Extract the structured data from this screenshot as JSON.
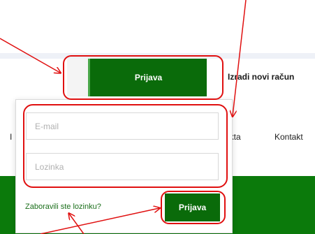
{
  "header": {
    "login_tab_label": "Prijava",
    "register_label": "Izradi novi račun"
  },
  "nav": {
    "items": [
      "I",
      "ekta",
      "Kontakt"
    ]
  },
  "login_form": {
    "email_placeholder": "E-mail",
    "password_placeholder": "Lozinka",
    "forgot_password_label": "Zaboravili ste lozinku?",
    "submit_label": "Prijava"
  },
  "colors": {
    "brand_green": "#0a6b0a",
    "annotation_red": "#e01010"
  }
}
